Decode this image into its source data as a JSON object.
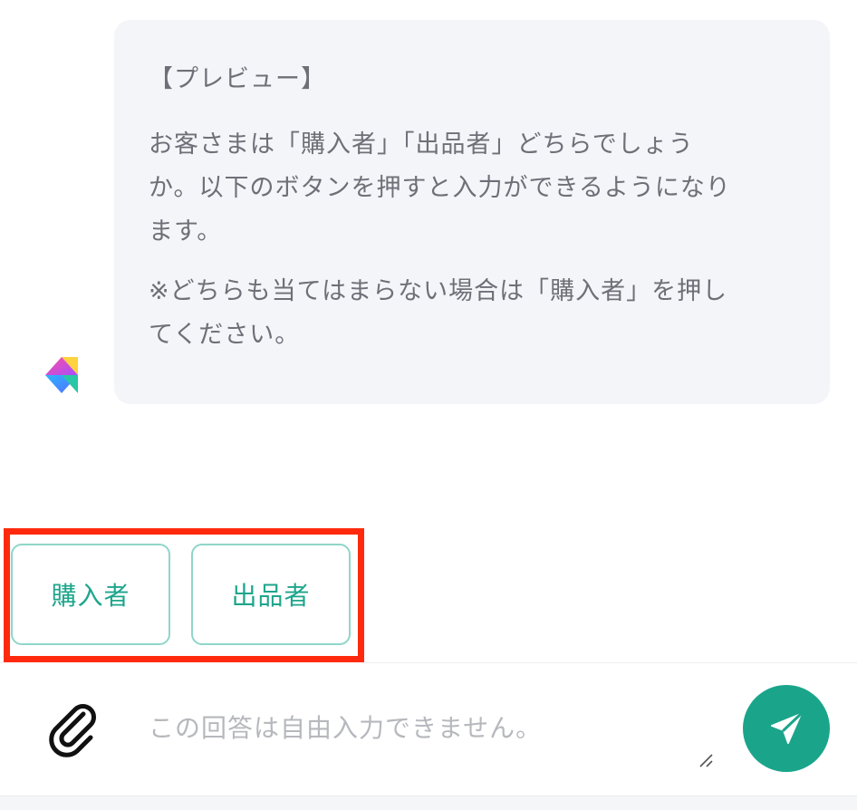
{
  "message": {
    "title": "【プレビュー】",
    "body": "お客さまは「購入者」「出品者」どちらでしょう\nか。以下のボタンを押すと入力ができるようになり\nます。",
    "note": "※どちらも当てはまらない場合は「購入者」を押し\nてください。",
    "avatar_icon": "bot-logo-icon"
  },
  "choices": [
    {
      "label": "購入者"
    },
    {
      "label": "出品者"
    }
  ],
  "composer": {
    "placeholder": "この回答は自由入力できません。",
    "attach_icon": "paperclip-icon",
    "send_icon": "paper-plane-icon"
  },
  "colors": {
    "accent": "#1aa58b",
    "highlight": "#ff2a0d",
    "bubble_bg": "#f4f5f9"
  }
}
